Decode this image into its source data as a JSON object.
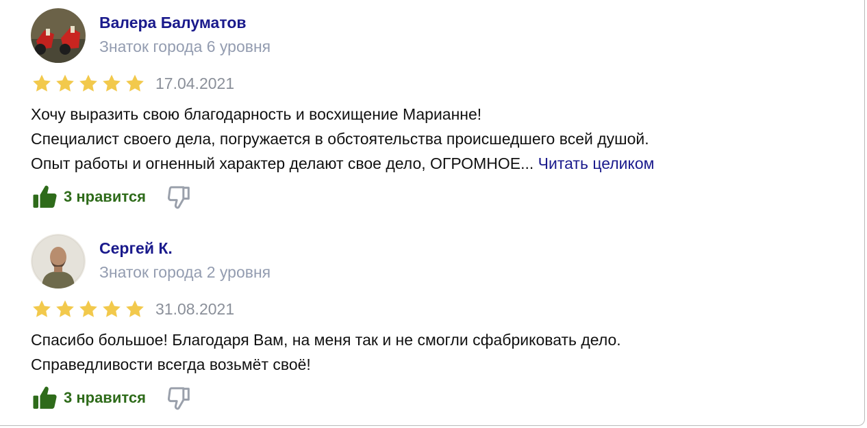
{
  "reviews": [
    {
      "author": "Валера Балуматов",
      "badge": "Знаток города 6 уровня",
      "rating": 5,
      "date": "17.04.2021",
      "lines": [
        "Хочу выразить свою благодарность и восхищение Марианне!",
        "Специалист своего дела, погружается в обстоятельства происшедшего всей душой.",
        "Опыт работы и огненный характер делают свое дело, ОГРОМНОЕ..."
      ],
      "read_more": "Читать целиком",
      "likes_label": "3 нравится"
    },
    {
      "author": "Сергей К.",
      "badge": "Знаток города 2 уровня",
      "rating": 5,
      "date": "31.08.2021",
      "lines": [
        "Спасибо большое! Благодаря Вам, на меня так и не смогли сфабриковать дело.",
        "Справедливости всегда возьмёт своё!"
      ],
      "likes_label": "3 нравится"
    }
  ],
  "colors": {
    "author": "#1a1a8c",
    "badge": "#939cb0",
    "star": "#f2c94c",
    "like": "#2e6b1a",
    "dislike_outline": "#9aa0ab"
  }
}
